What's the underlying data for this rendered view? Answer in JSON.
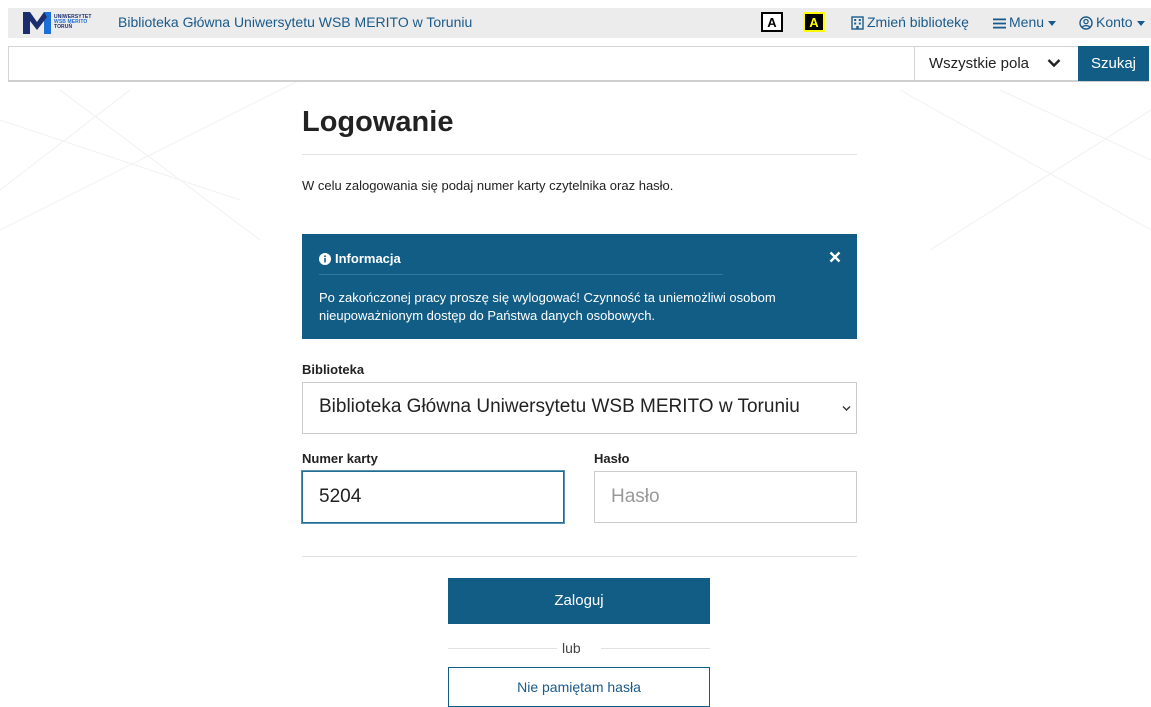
{
  "header": {
    "logo": {
      "line1": "UNIWERSYTET",
      "line2": "WSB MERITO",
      "line3": "TORUŃ"
    },
    "site_title": "Biblioteka Główna Uniwersytetu WSB MERITO w Toruniu",
    "contrast_normal": "A",
    "contrast_high": "A",
    "change_library": "Zmień bibliotekę",
    "menu": "Menu",
    "account": "Konto"
  },
  "search": {
    "value": "",
    "field_selected": "Wszystkie pola",
    "button": "Szukaj"
  },
  "page": {
    "title": "Logowanie",
    "intro": "W celu zalogowania się podaj numer karty czytelnika oraz hasło."
  },
  "alert": {
    "title": "Informacja",
    "body": "Po zakończonej pracy proszę się wylogować! Czynność ta uniemożliwi osobom nieupoważnionym dostęp do Państwa danych osobowych."
  },
  "form": {
    "library_label": "Biblioteka",
    "library_value": "Biblioteka Główna Uniwersytetu WSB MERITO w Toruniu",
    "card_label": "Numer karty",
    "card_value": "5204",
    "password_label": "Hasło",
    "password_placeholder": "Hasło",
    "login_button": "Zaloguj",
    "or_text": "lub",
    "forgot_button": "Nie pamiętam hasła"
  },
  "colors": {
    "primary": "#125d86",
    "link": "#1a5a8a",
    "topbar_bg": "#ececec",
    "logo_navy": "#1a2e6e",
    "logo_blue": "#1d6fd8"
  },
  "icons": {
    "library": "building-icon",
    "menu": "hamburger-icon",
    "account": "user-circle-icon",
    "alert": "info-circle-icon",
    "close": "close-icon",
    "select": "chevron-down-icon"
  }
}
